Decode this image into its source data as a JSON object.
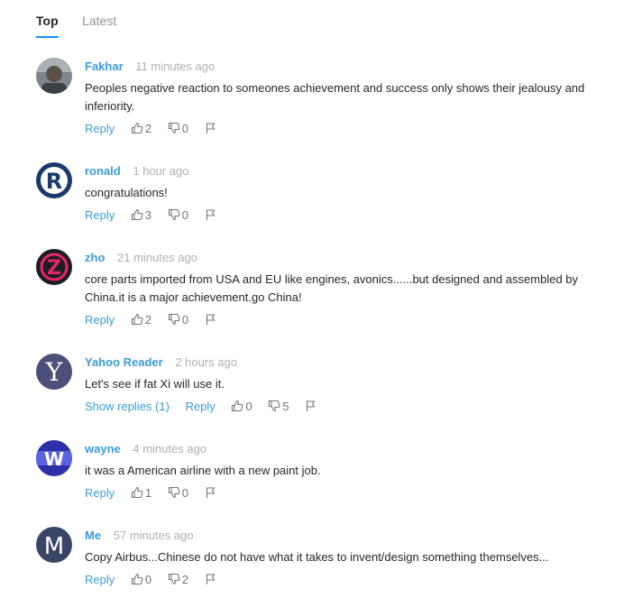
{
  "tabs": [
    {
      "label": "Top",
      "active": true
    },
    {
      "label": "Latest",
      "active": false
    }
  ],
  "labels": {
    "reply": "Reply"
  },
  "comments": [
    {
      "author": "Fakhar",
      "time": "11 minutes ago",
      "text": "Peoples negative reaction to someones achievement and success only shows their jealousy and inferiority.",
      "likes": "2",
      "dislikes": "0",
      "avatar": {
        "type": "photo",
        "color": "#6a7279"
      }
    },
    {
      "author": "ronald",
      "time": "1 hour ago",
      "text": "congratulations!",
      "likes": "3",
      "dislikes": "0",
      "avatar": {
        "type": "letter",
        "letter": "R",
        "bg": "#1b3a6b",
        "fg": "#ffffff"
      }
    },
    {
      "author": "zho",
      "time": "21 minutes ago",
      "text": "core parts imported from USA and EU like engines, avonics......but designed and assembled by China.it is a major achievement.go China!",
      "likes": "2",
      "dislikes": "0",
      "avatar": {
        "type": "letter",
        "letter": "Z",
        "bg": "#1c1c24",
        "fg": "#e8246a"
      }
    },
    {
      "author": "Yahoo Reader",
      "time": "2 hours ago",
      "text": "Let's see if fat Xi will use it.",
      "show_replies": "Show replies (1)",
      "likes": "0",
      "dislikes": "5",
      "avatar": {
        "type": "letter",
        "letter": "Y",
        "bg": "#4b4f7a",
        "fg": "#ffffff"
      }
    },
    {
      "author": "wayne",
      "time": "4 minutes ago",
      "text": "it was a American airline with a new paint job.",
      "likes": "1",
      "dislikes": "0",
      "avatar": {
        "type": "letter",
        "letter": "W",
        "bg": "#2c2fa6",
        "fg": "#ffffff"
      }
    },
    {
      "author": "Me",
      "time": "57 minutes ago",
      "text": "Copy Airbus...Chinese do not have what it takes to invent/design something themselves...",
      "likes": "0",
      "dislikes": "2",
      "avatar": {
        "type": "letter",
        "letter": "M",
        "bg": "#3a4466",
        "fg": "#ffffff"
      }
    }
  ]
}
